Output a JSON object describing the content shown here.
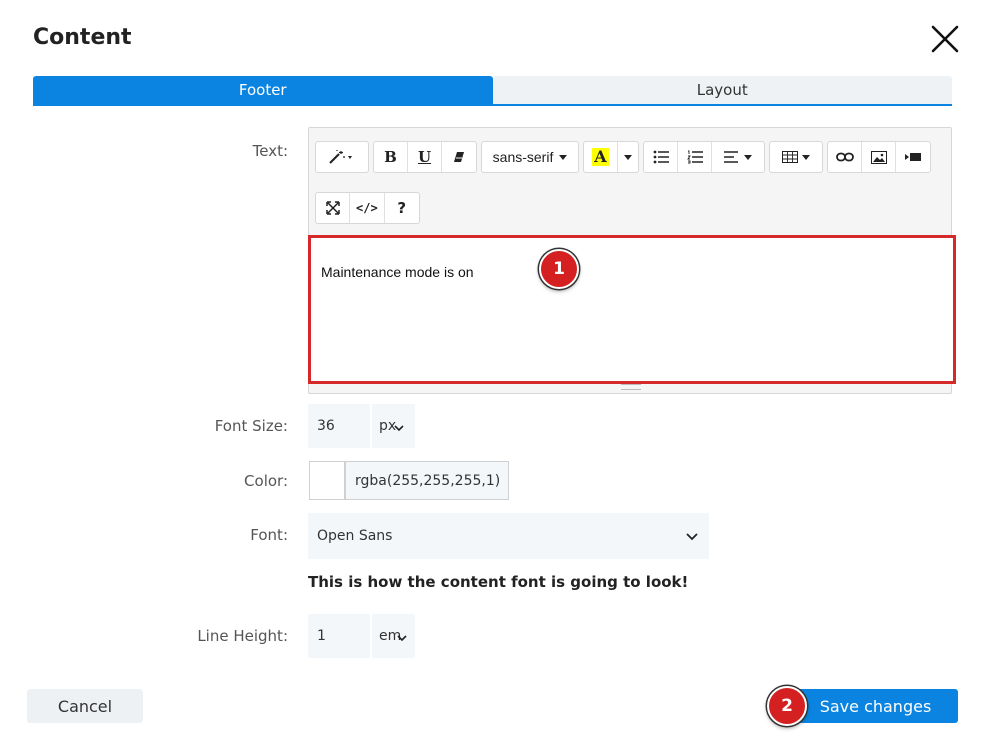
{
  "dialog": {
    "title": "Content"
  },
  "tabs": [
    {
      "label": "Footer"
    },
    {
      "label": "Layout"
    }
  ],
  "form": {
    "text_label": "Text:",
    "font_size_label": "Font Size:",
    "color_label": "Color:",
    "font_label": "Font:",
    "line_height_label": "Line Height:"
  },
  "editor": {
    "font_family_dropdown": "sans-serif",
    "content": "Maintenance mode is on",
    "highlight_color": "#ffff00"
  },
  "font_size": {
    "value": "36",
    "unit": "px"
  },
  "color": {
    "swatch": "#ffffff",
    "value": "rgba(255,255,255,1)"
  },
  "font": {
    "selected": "Open Sans",
    "preview": "This is how the content font is going to look!"
  },
  "line_height": {
    "value": "1",
    "unit": "em"
  },
  "buttons": {
    "cancel": "Cancel",
    "save": "Save changes"
  },
  "markers": {
    "one": "1",
    "two": "2"
  },
  "colors": {
    "accent": "#0a84e0",
    "marker": "#d42020"
  }
}
